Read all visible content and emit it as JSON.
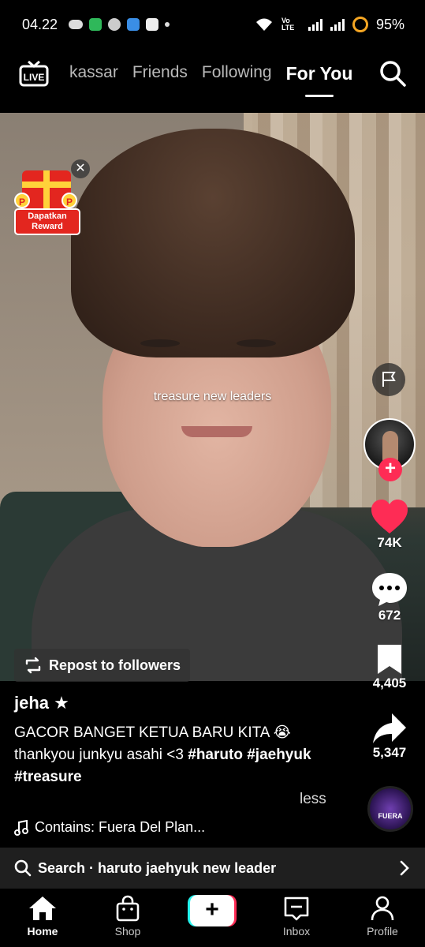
{
  "status_bar": {
    "time": "04.22",
    "network": "Vo LTE",
    "battery": "95%"
  },
  "top_nav": {
    "live_label": "LIVE",
    "tabs": [
      "kassar",
      "Friends",
      "Following",
      "For You"
    ],
    "active_tab": "For You"
  },
  "video": {
    "overlay_text": "treasure new leaders"
  },
  "reward_widget": {
    "coin_letter": "P",
    "label": "Dapatkan Reward"
  },
  "rail": {
    "likes": "74K",
    "comments": "672",
    "saves": "4,405",
    "shares": "5,347",
    "music_disc_text": "FUERA",
    "like_color": "#fe2c55"
  },
  "repost": {
    "label": "Repost to followers"
  },
  "post": {
    "username": "jeha ★",
    "caption_text": "GACOR BANGET KETUA BARU KITA 😭 thankyou junkyu asahi <3",
    "hashtags": [
      "#haruto",
      "#jaehyuk",
      "#treasure"
    ],
    "less_label": "less",
    "sound": "Contains: Fuera Del Plan..."
  },
  "search_suggestion": {
    "text": "Search · haruto jaehyuk new leader"
  },
  "bottom_nav": {
    "items": [
      {
        "label": "Home"
      },
      {
        "label": "Shop"
      },
      {
        "label": "Inbox"
      },
      {
        "label": "Profile"
      }
    ],
    "create_label": "+"
  }
}
